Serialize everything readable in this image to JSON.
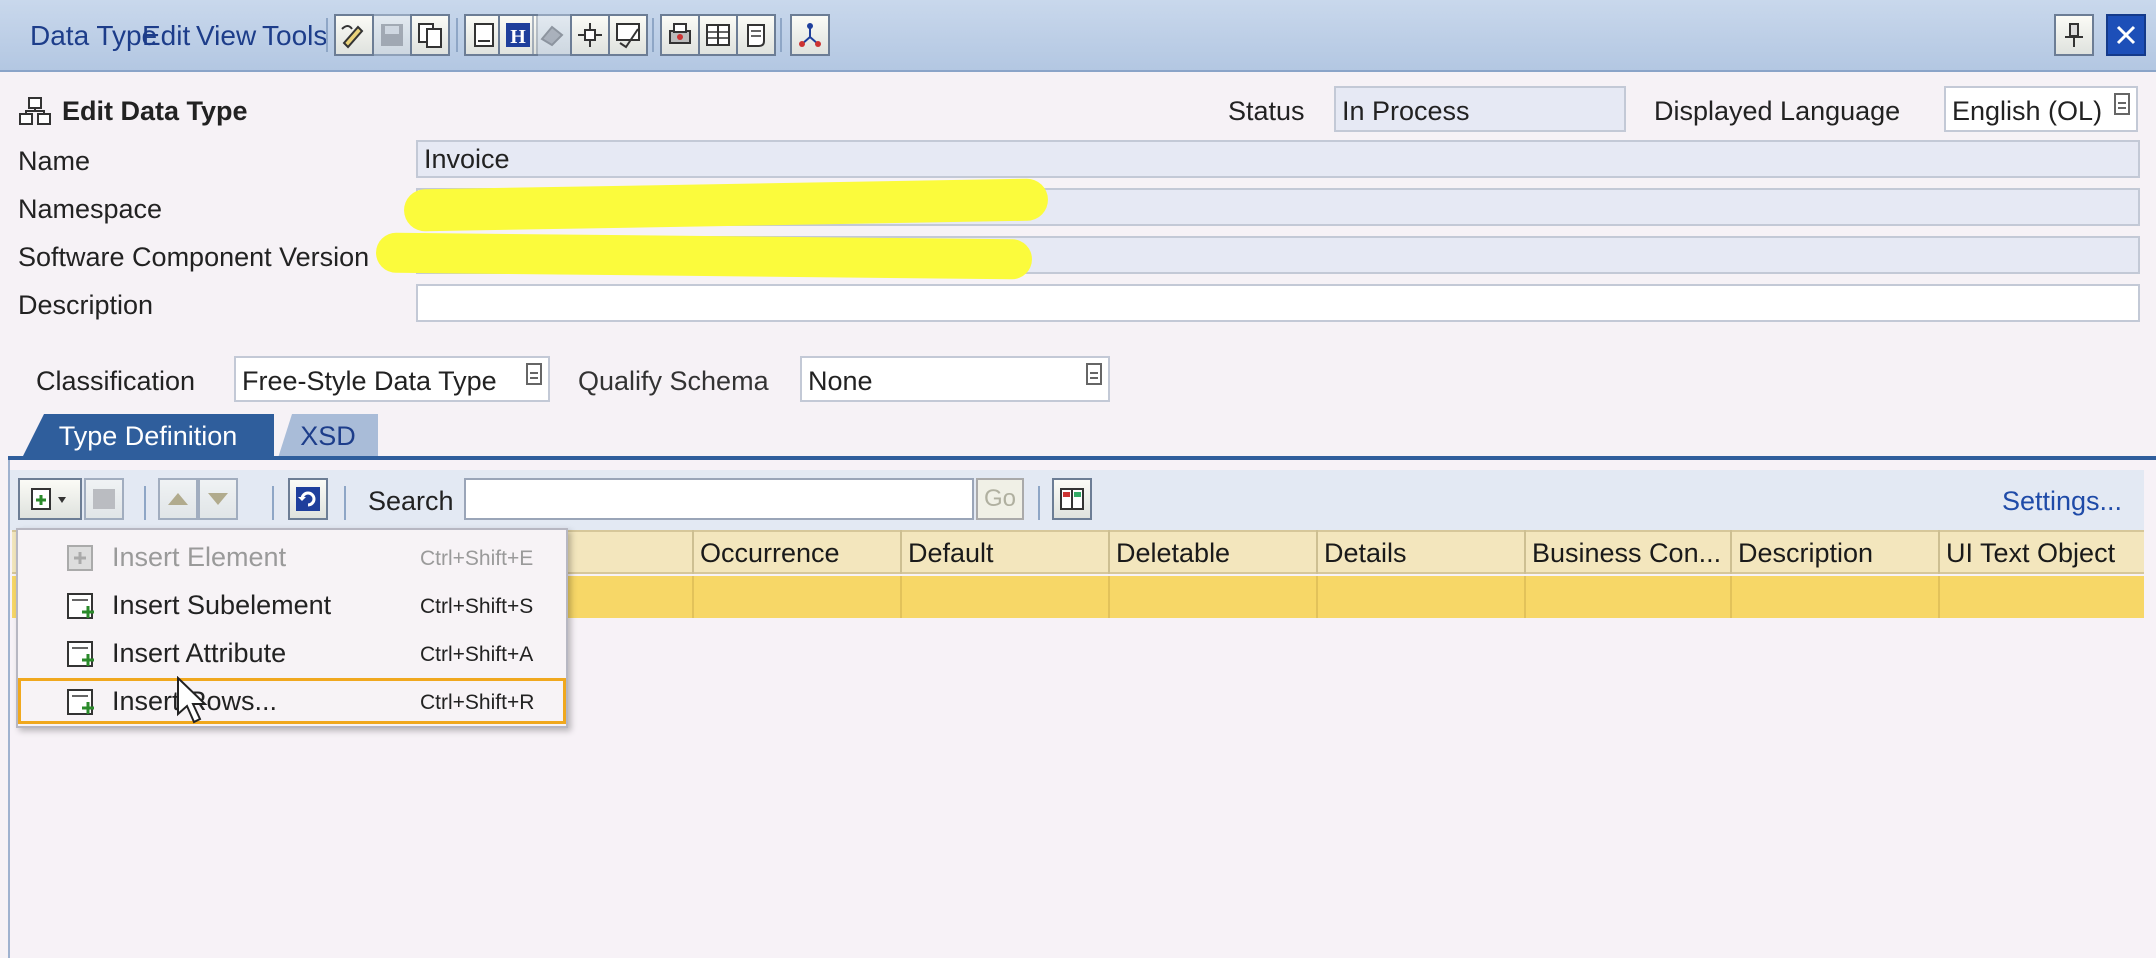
{
  "menu": [
    "Data Type",
    "Edit",
    "View",
    "Tools"
  ],
  "toolbar_icons": [
    "pen-icon",
    "save-icon",
    "copy-icon",
    "document-icon",
    "info-icon",
    "eraser-icon",
    "move-icon",
    "check-icon",
    "print-icon",
    "table-icon",
    "scroll-icon",
    "network-icon"
  ],
  "window_buttons": [
    "pin-icon",
    "close-icon"
  ],
  "header": {
    "title": "Edit Data Type",
    "status_label": "Status",
    "status_value": "In Process",
    "language_label": "Displayed Language",
    "language_value": "English (OL)"
  },
  "form": {
    "name_label": "Name",
    "name_value": "Invoice",
    "namespace_label": "Namespace",
    "namespace_value": "",
    "swcv_label": "Software Component Version",
    "swcv_value": "",
    "description_label": "Description",
    "description_value": "",
    "classification_label": "Classification",
    "classification_value": "Free-Style Data Type",
    "qualify_label": "Qualify Schema",
    "qualify_value": "None"
  },
  "tabs": [
    "Type Definition",
    "XSD"
  ],
  "table_toolbar": {
    "search_label": "Search",
    "search_value": "",
    "go_label": "Go",
    "settings_label": "Settings..."
  },
  "columns": [
    "Occurrence",
    "Default",
    "Deletable",
    "Details",
    "Business Con...",
    "Description",
    "UI Text Object"
  ],
  "insert_menu": [
    {
      "label": "Insert Element",
      "shortcut": "Ctrl+Shift+E",
      "enabled": false
    },
    {
      "label": "Insert Subelement",
      "shortcut": "Ctrl+Shift+S",
      "enabled": true
    },
    {
      "label": "Insert Attribute",
      "shortcut": "Ctrl+Shift+A",
      "enabled": true
    },
    {
      "label": "Insert Rows...",
      "shortcut": "Ctrl+Shift+R",
      "enabled": true,
      "highlighted": true
    }
  ],
  "colors": {
    "accent": "#2f5e9c",
    "header_row": "#f3e6bd",
    "selected_row": "#f7d767",
    "menu_highlight": "#f0a81e",
    "redaction": "#fbfb3c"
  }
}
